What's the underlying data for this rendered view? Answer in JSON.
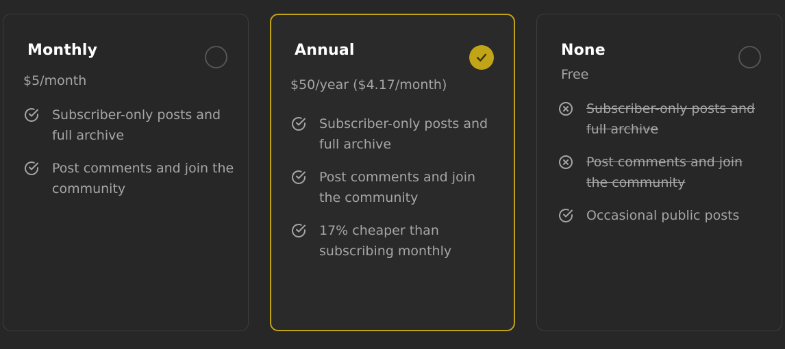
{
  "plans": [
    {
      "title": "Monthly",
      "price": "$5/month",
      "selected": false,
      "features": [
        {
          "text": "Subscriber-only posts and full archive",
          "included": true
        },
        {
          "text": "Post comments and join the community",
          "included": true
        }
      ]
    },
    {
      "title": "Annual",
      "price": "$50/year ($4.17/month)",
      "selected": true,
      "features": [
        {
          "text": "Subscriber-only posts and full archive",
          "included": true
        },
        {
          "text": "Post comments and join the community",
          "included": true
        },
        {
          "text": "17% cheaper than subscribing monthly",
          "included": true
        }
      ]
    },
    {
      "title": "None",
      "price": "Free",
      "selected": false,
      "features": [
        {
          "text": "Subscriber-only posts and full archive",
          "included": false
        },
        {
          "text": "Post comments and join the community",
          "included": false
        },
        {
          "text": "Occasional public posts",
          "included": true
        }
      ]
    }
  ],
  "icons": {
    "included": "check-circle-icon",
    "excluded": "x-circle-icon",
    "selected": "check-icon"
  },
  "colors": {
    "accent": "#c2a516",
    "background": "#272727",
    "text": "#a6a6a6",
    "title": "#ffffff"
  }
}
